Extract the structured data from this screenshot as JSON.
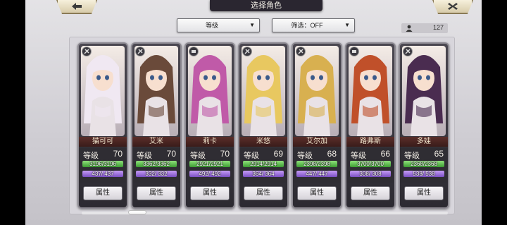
{
  "header": {
    "title": "选择角色"
  },
  "filters": {
    "sort_label": "等级",
    "filter_label": "筛选：OFF",
    "character_count": "127"
  },
  "cards": [
    {
      "name": "猫可可",
      "level_label": "等级",
      "level": "70",
      "hp": "3196/3196",
      "mp": "437/ 437",
      "attr_label": "属性",
      "palette": "#f0e8f2"
    },
    {
      "name": "艾米",
      "level_label": "等级",
      "level": "70",
      "hp": "3362/3362",
      "mp": "332/ 332",
      "attr_label": "属性",
      "palette": "#6a4a3a"
    },
    {
      "name": "莉卡",
      "level_label": "等级",
      "level": "70",
      "hp": "2921/2921",
      "mp": "492/ 492",
      "attr_label": "属性",
      "palette": "#c05aa8"
    },
    {
      "name": "米悠",
      "level_label": "等级",
      "level": "69",
      "hp": "2914/2914",
      "mp": "364/ 364",
      "attr_label": "属性",
      "palette": "#e8c860"
    },
    {
      "name": "艾尔加",
      "level_label": "等级",
      "level": "68",
      "hp": "2398/2398",
      "mp": "447/ 447",
      "attr_label": "属性",
      "palette": "#d8b050"
    },
    {
      "name": "路弗斯",
      "level_label": "等级",
      "level": "66",
      "hp": "3700/3700",
      "mp": "308/ 308",
      "attr_label": "属性",
      "palette": "#c0502a"
    },
    {
      "name": "多娃",
      "level_label": "等级",
      "level": "65",
      "hp": "2368/2368",
      "mp": "538/ 538",
      "attr_label": "属性",
      "palette": "#4a2c50"
    }
  ]
}
